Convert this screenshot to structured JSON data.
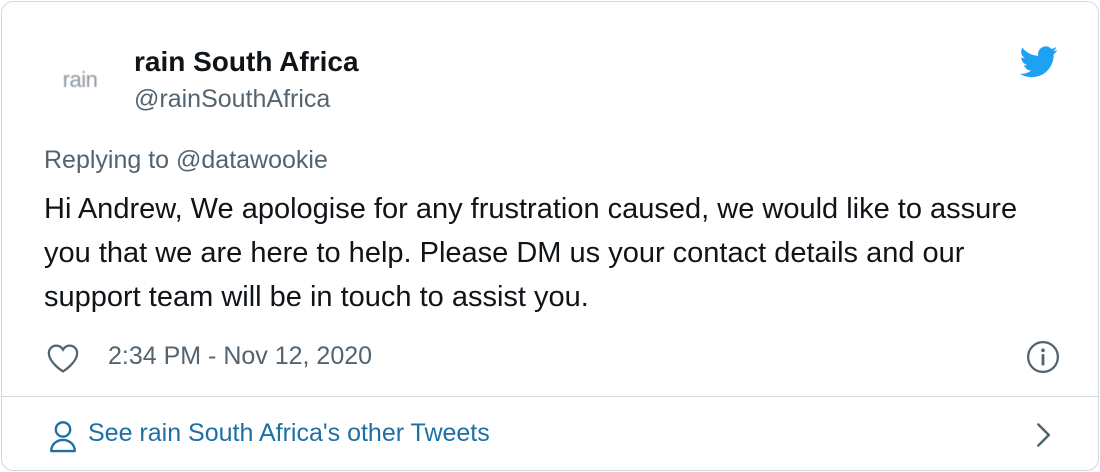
{
  "author": {
    "avatar_text": "rain",
    "name": "rain South Africa",
    "handle": "@rainSouthAfrica"
  },
  "tweet": {
    "replying_to": "Replying to @datawookie",
    "text": "Hi Andrew, We apologise for any frustration caused, we would like to assure you that we are here to help. Please DM us your contact details and our support team will be in touch to assist you.",
    "timestamp": "2:34 PM - Nov 12, 2020"
  },
  "footer": {
    "link_label": "See rain South Africa's other Tweets"
  },
  "icons": {
    "brand": "twitter-bird-icon",
    "like": "heart-icon",
    "info": "info-icon",
    "profile": "person-icon",
    "chevron": "chevron-right-icon"
  },
  "colors": {
    "twitter_blue": "#1da1f2",
    "link_blue": "#1d6fa5",
    "text_primary": "#0f1419",
    "text_secondary": "#536471",
    "border": "#cfd9de"
  }
}
